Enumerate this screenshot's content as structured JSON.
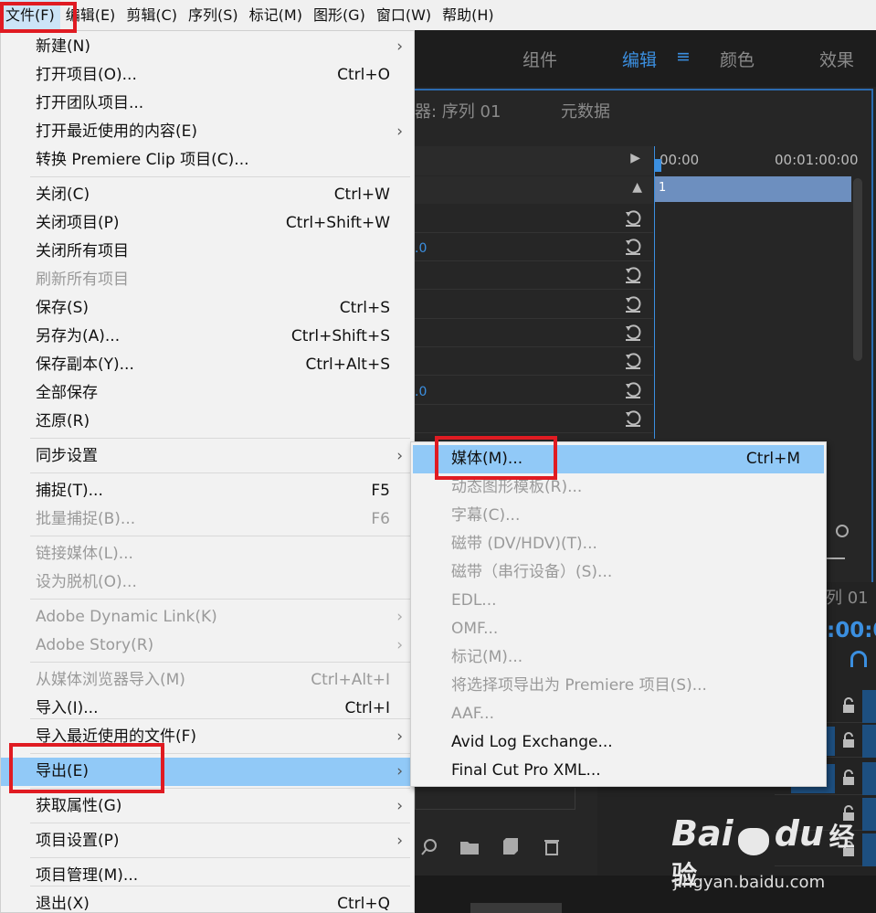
{
  "menubar": {
    "items": [
      "文件(F)",
      "编辑(E)",
      "剪辑(C)",
      "序列(S)",
      "标记(M)",
      "图形(G)",
      "窗口(W)",
      "帮助(H)"
    ]
  },
  "workspaces": {
    "items": [
      "组件",
      "编辑",
      "颜色",
      "效果"
    ],
    "active": "编辑",
    "menu_icon": "≡"
  },
  "panels": {
    "effect_controls_title": "器: 序列 01",
    "metadata_title": "元数据",
    "timecode_start": "00:00",
    "timecode_end": "00:01:00:00",
    "clip_label": "1",
    "value_a": ".0",
    "value_b": ".0",
    "seq_title": "列 01",
    "seq_timecode": ":00:0"
  },
  "file_menu": {
    "items": [
      {
        "label": "新建(N)",
        "shortcut": "",
        "submenu": true,
        "disabled": false
      },
      {
        "label": "打开项目(O)...",
        "shortcut": "Ctrl+O",
        "submenu": false,
        "disabled": false
      },
      {
        "label": "打开团队项目...",
        "shortcut": "",
        "submenu": false,
        "disabled": false
      },
      {
        "label": "打开最近使用的内容(E)",
        "shortcut": "",
        "submenu": true,
        "disabled": false
      },
      {
        "label": "转换 Premiere Clip 项目(C)...",
        "shortcut": "",
        "submenu": false,
        "disabled": false
      },
      {
        "label": "关闭(C)",
        "shortcut": "Ctrl+W",
        "submenu": false,
        "disabled": false
      },
      {
        "label": "关闭项目(P)",
        "shortcut": "Ctrl+Shift+W",
        "submenu": false,
        "disabled": false
      },
      {
        "label": "关闭所有项目",
        "shortcut": "",
        "submenu": false,
        "disabled": false
      },
      {
        "label": "刷新所有项目",
        "shortcut": "",
        "submenu": false,
        "disabled": true
      },
      {
        "label": "保存(S)",
        "shortcut": "Ctrl+S",
        "submenu": false,
        "disabled": false
      },
      {
        "label": "另存为(A)...",
        "shortcut": "Ctrl+Shift+S",
        "submenu": false,
        "disabled": false
      },
      {
        "label": "保存副本(Y)...",
        "shortcut": "Ctrl+Alt+S",
        "submenu": false,
        "disabled": false
      },
      {
        "label": "全部保存",
        "shortcut": "",
        "submenu": false,
        "disabled": false
      },
      {
        "label": "还原(R)",
        "shortcut": "",
        "submenu": false,
        "disabled": false
      },
      {
        "label": "同步设置",
        "shortcut": "",
        "submenu": true,
        "disabled": false
      },
      {
        "label": "捕捉(T)...",
        "shortcut": "F5",
        "submenu": false,
        "disabled": false
      },
      {
        "label": "批量捕捉(B)...",
        "shortcut": "F6",
        "submenu": false,
        "disabled": true
      },
      {
        "label": "链接媒体(L)...",
        "shortcut": "",
        "submenu": false,
        "disabled": true
      },
      {
        "label": "设为脱机(O)...",
        "shortcut": "",
        "submenu": false,
        "disabled": true
      },
      {
        "label": "Adobe Dynamic Link(K)",
        "shortcut": "",
        "submenu": true,
        "disabled": true
      },
      {
        "label": "Adobe Story(R)",
        "shortcut": "",
        "submenu": true,
        "disabled": true
      },
      {
        "label": "从媒体浏览器导入(M)",
        "shortcut": "Ctrl+Alt+I",
        "submenu": false,
        "disabled": true
      },
      {
        "label": "导入(I)...",
        "shortcut": "Ctrl+I",
        "submenu": false,
        "disabled": false
      },
      {
        "label": "导入最近使用的文件(F)",
        "shortcut": "",
        "submenu": true,
        "disabled": false
      },
      {
        "label": "导出(E)",
        "shortcut": "",
        "submenu": true,
        "disabled": false,
        "selected": true
      },
      {
        "label": "获取属性(G)",
        "shortcut": "",
        "submenu": true,
        "disabled": false
      },
      {
        "label": "项目设置(P)",
        "shortcut": "",
        "submenu": true,
        "disabled": false
      },
      {
        "label": "项目管理(M)...",
        "shortcut": "",
        "submenu": false,
        "disabled": false
      },
      {
        "label": "退出(X)",
        "shortcut": "Ctrl+Q",
        "submenu": false,
        "disabled": false
      }
    ]
  },
  "export_submenu": {
    "items": [
      {
        "label": "媒体(M)...",
        "shortcut": "Ctrl+M",
        "disabled": false,
        "selected": true
      },
      {
        "label": "动态图形模板(R)...",
        "shortcut": "",
        "disabled": true
      },
      {
        "label": "字幕(C)...",
        "shortcut": "",
        "disabled": true
      },
      {
        "label": "磁带 (DV/HDV)(T)...",
        "shortcut": "",
        "disabled": true
      },
      {
        "label": "磁带（串行设备）(S)...",
        "shortcut": "",
        "disabled": true
      },
      {
        "label": "EDL...",
        "shortcut": "",
        "disabled": true
      },
      {
        "label": "OMF...",
        "shortcut": "",
        "disabled": true
      },
      {
        "label": "标记(M)...",
        "shortcut": "",
        "disabled": true
      },
      {
        "label": "将选择项导出为 Premiere 项目(S)...",
        "shortcut": "",
        "disabled": true
      },
      {
        "label": "AAF...",
        "shortcut": "",
        "disabled": true
      },
      {
        "label": "Avid Log Exchange...",
        "shortcut": "",
        "disabled": false
      },
      {
        "label": "Final Cut Pro XML...",
        "shortcut": "",
        "disabled": false
      }
    ]
  },
  "watermark": {
    "brand": "Bai",
    "brand2": "du",
    "cn": "经验",
    "url": "jingyan.baidu.com"
  },
  "colors": {
    "highlight_box": "#e01b22",
    "menu_selected": "#91c9f7",
    "accent": "#3b8fe0"
  }
}
